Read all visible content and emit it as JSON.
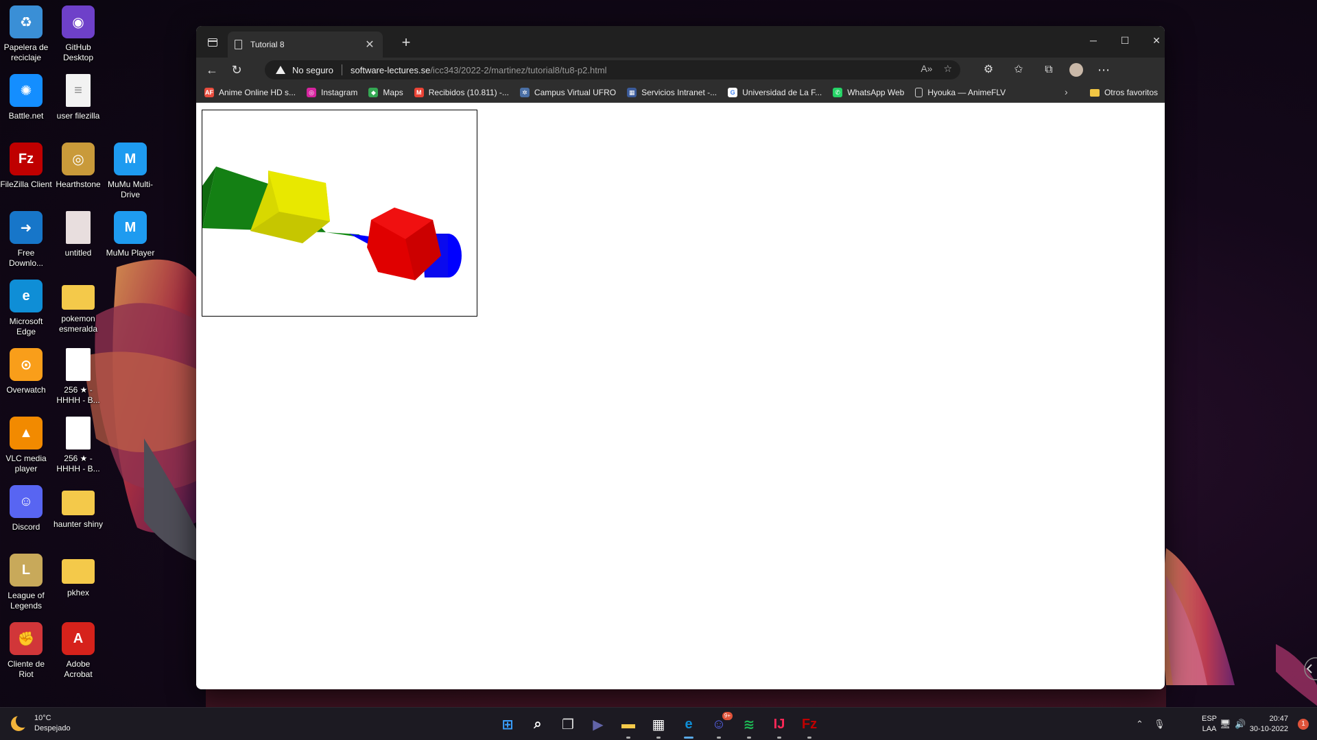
{
  "desktop": {
    "icons": [
      {
        "label": "Papelera de reciclaje",
        "icon": "recycle-bin-icon",
        "color": "#3a8fd6"
      },
      {
        "label": "GitHub Desktop",
        "icon": "github-icon",
        "color": "#6e40c9"
      },
      {
        "label": "Battle.net",
        "icon": "battlenet-icon",
        "color": "#148eff"
      },
      {
        "label": "user filezilla",
        "icon": "text-file-icon",
        "color": "#f2f2f2"
      },
      {
        "label": "FileZilla Client",
        "icon": "filezilla-icon",
        "color": "#bf0000"
      },
      {
        "label": "Hearthstone",
        "icon": "hearthstone-icon",
        "color": "#c99a3a"
      },
      {
        "label": "MuMu Multi-Drive",
        "icon": "mumu-icon",
        "color": "#1e9bf0"
      },
      {
        "label": "Free Downlo...",
        "icon": "free-download-icon",
        "color": "#1776c9"
      },
      {
        "label": "untitled",
        "icon": "blank-file-icon",
        "color": "#e8dede"
      },
      {
        "label": "MuMu Player",
        "icon": "mumu-player-icon",
        "color": "#1e9bf0"
      },
      {
        "label": "Microsoft Edge",
        "icon": "edge-icon",
        "color": "#0f8ed6"
      },
      {
        "label": "pokemon esmeralda",
        "icon": "folder-icon",
        "color": "#f4c94a"
      },
      {
        "label": "Overwatch",
        "icon": "overwatch-icon",
        "color": "#f99e1a"
      },
      {
        "label": "256 ★ - HHHH - B...",
        "icon": "blank-file-icon",
        "color": "#ffffff"
      },
      {
        "label": "VLC media player",
        "icon": "vlc-icon",
        "color": "#f28a00"
      },
      {
        "label": "256 ★ - HHHH - B...",
        "icon": "blank-file-icon",
        "color": "#ffffff"
      },
      {
        "label": "Discord",
        "icon": "discord-icon",
        "color": "#5865f2"
      },
      {
        "label": "haunter shiny",
        "icon": "folder-icon",
        "color": "#f4c94a"
      },
      {
        "label": "League of Legends",
        "icon": "league-icon",
        "color": "#c8a95a"
      },
      {
        "label": "pkhex",
        "icon": "folder-icon",
        "color": "#f4c94a"
      },
      {
        "label": "Cliente de Riot",
        "icon": "riot-icon",
        "color": "#d13639"
      },
      {
        "label": "Adobe Acrobat",
        "icon": "acrobat-icon",
        "color": "#d6221b"
      }
    ]
  },
  "browser": {
    "tab_title": "Tutorial 8",
    "address": {
      "security_label": "No seguro",
      "host": "software-lectures.se",
      "path": "/icc343/2022-2/martinez/tutorial8/tu8-p2.html"
    },
    "bookmarks": [
      {
        "label": "Anime Online HD s...",
        "icon": "animeflv-icon",
        "color": "#e84c3d",
        "glyph": "AF"
      },
      {
        "label": "Instagram",
        "icon": "instagram-icon",
        "color": "#d6249f",
        "glyph": "◎"
      },
      {
        "label": "Maps",
        "icon": "maps-icon",
        "color": "#34a853",
        "glyph": "◆"
      },
      {
        "label": "Recibidos (10.811) -...",
        "icon": "gmail-icon",
        "color": "#ea4335",
        "glyph": "M"
      },
      {
        "label": "Campus Virtual UFRO",
        "icon": "campus-icon",
        "color": "#4a6fa5",
        "glyph": "✲"
      },
      {
        "label": "Servicios Intranet -...",
        "icon": "intranet-icon",
        "color": "#3b5b9a",
        "glyph": "▦"
      },
      {
        "label": "Universidad de La F...",
        "icon": "google-icon",
        "color": "#ffffff",
        "glyph": "G"
      },
      {
        "label": "WhatsApp Web",
        "icon": "whatsapp-icon",
        "color": "#25d366",
        "glyph": "✆"
      },
      {
        "label": "Hyouka — AnimeFLV",
        "icon": "page-icon",
        "color": "#2e2e2e",
        "glyph": "▯"
      }
    ],
    "other_favorites": "Otros favoritos"
  },
  "taskbar": {
    "weather": {
      "temp": "10°C",
      "condition": "Despejado"
    },
    "apps": [
      {
        "name": "start-button",
        "icon": "windows-icon",
        "color": "#3aa0ff"
      },
      {
        "name": "search-button",
        "icon": "search-icon",
        "color": "#ffffff"
      },
      {
        "name": "task-view-button",
        "icon": "task-view-icon",
        "color": "#dddddd"
      },
      {
        "name": "teams-chat-button",
        "icon": "teams-icon",
        "color": "#6264a7"
      },
      {
        "name": "file-explorer-button",
        "icon": "folder-icon",
        "color": "#f4c94a"
      },
      {
        "name": "microsoft-store-button",
        "icon": "store-icon",
        "color": "#ffffff"
      },
      {
        "name": "edge-taskbar-button",
        "icon": "edge-icon",
        "color": "#0f8ed6"
      },
      {
        "name": "discord-taskbar-button",
        "icon": "discord-icon",
        "color": "#5865f2"
      },
      {
        "name": "spotify-taskbar-button",
        "icon": "spotify-icon",
        "color": "#1db954"
      },
      {
        "name": "intellij-taskbar-button",
        "icon": "intellij-icon",
        "color": "#fe2857"
      },
      {
        "name": "filezilla-taskbar-button",
        "icon": "filezilla-icon",
        "color": "#bf0000"
      }
    ],
    "discord_badge": "9+",
    "lang": {
      "line1": "ESP",
      "line2": "LAA"
    },
    "clock": {
      "time": "20:47",
      "date": "30-10-2022"
    },
    "notifications": "1"
  }
}
